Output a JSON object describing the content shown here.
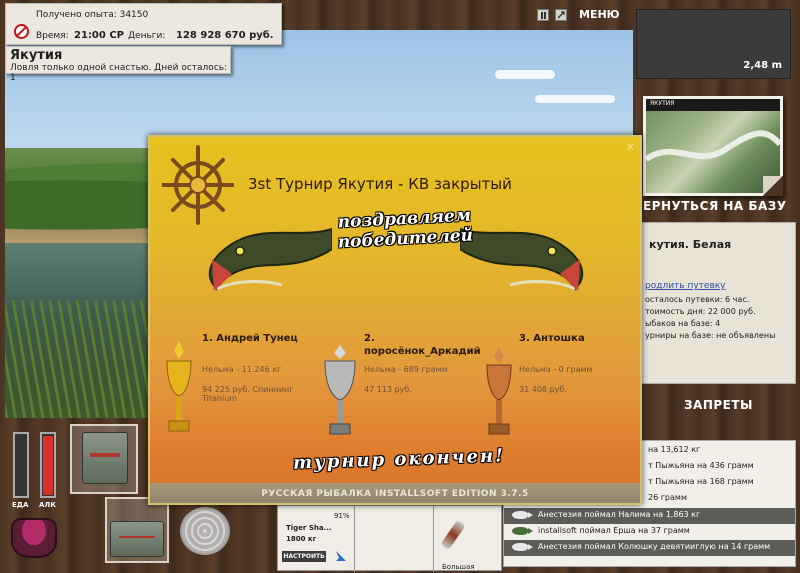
{
  "hud": {
    "experience_text": "Получено опыта: 34150",
    "time_label": "Время:",
    "time_value": "21:00 СР",
    "money_label": "Деньги:",
    "money_value": "128 928 670 руб.",
    "location_title": "Якутия",
    "location_subtitle": "Ловля только одной снастью. Дней осталось: 1",
    "menu_label": "МЕНЮ",
    "depth": "2,48 m",
    "return_label": "ЗЕРНУТЬСЯ НА БАЗУ",
    "bans_label": "ЗАПРЕТЫ",
    "food_label": "ЕДА",
    "alc_label": "АЛК",
    "food_level": 0.0,
    "alc_level": 0.95
  },
  "map_card": {
    "header": "ЯКУТИЯ"
  },
  "base_panel": {
    "title": "кутия. Белая",
    "link": "родлить путевку",
    "lines": [
      "осталось путевки: 6 час.",
      "тоимость дня: 22 000 руб.",
      "ыбаков на базе: 4",
      "урниры на базе: не объявлены"
    ]
  },
  "catches": [
    "на 13,612 кг",
    "т Пыжьяна на 436 грамм",
    "т Пыжьяна на 168 грамм",
    "26 грамм",
    "Анестезия поймал Налима на 1,863 кг",
    "installsoft поймал Ерша на 37 грамм",
    "Анестезия поймал Колюшку девятииглую на 14 грамм"
  ],
  "rod_panel": {
    "rod_name": "Tiger Sha...",
    "rod_weight": "1800 кг",
    "rod_percent": "91%",
    "setup_label": "НАСТРОИТЬ",
    "lure_label": "Большая"
  },
  "tournament": {
    "title": "3st Турнир Якутия - КВ закрытый",
    "congrats_banner": "поздравляем победителей",
    "finish_banner": "турнир окончен!",
    "edition": "РУССКАЯ РЫБАЛКА INSTALLSOFT EDITION 3.7.5",
    "close_icon": "×",
    "winners": [
      {
        "place": "1. Андрей Тунец",
        "catch": "Нельма - 11.246 кг",
        "prize": "94 225 руб. Спиннинг Titanium"
      },
      {
        "place": "2. поросёнок_Аркадий",
        "place_num": "2.",
        "place_name": "поросёнок_Аркадий",
        "catch": "Нельма - 689 грамм",
        "prize": "47 113 руб."
      },
      {
        "place": "3. Антошка",
        "catch": "Нельма - 0 грамм",
        "prize": "31 408 руб."
      }
    ]
  },
  "colors": {
    "alc_fill": "#d8302a",
    "modal_top": "#e7c21f",
    "modal_bottom": "#d4742c"
  }
}
